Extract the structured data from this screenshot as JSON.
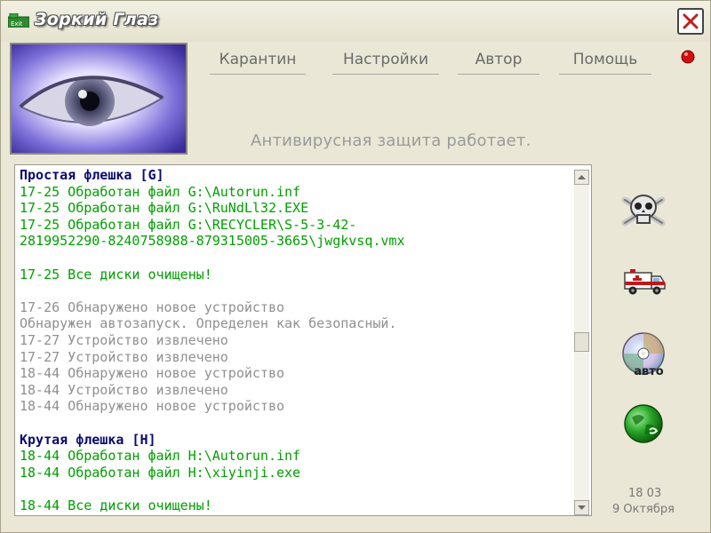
{
  "window": {
    "title": "Зоркий Глаз"
  },
  "menu": [
    {
      "label": "Карантин"
    },
    {
      "label": "Настройки"
    },
    {
      "label": "Автор"
    },
    {
      "label": "Помощь"
    }
  ],
  "status": {
    "text": "Антивирусная защита работает."
  },
  "log": [
    {
      "text": "Простая флешка [G]",
      "style": "header"
    },
    {
      "text": "17-25 Обработан файл G:\\Autorun.inf",
      "style": "green"
    },
    {
      "text": "17-25 Обработан файл G:\\RuNdLl32.EXE",
      "style": "green"
    },
    {
      "text": "17-25 Обработан файл G:\\RECYCLER\\S-5-3-42-",
      "style": "green"
    },
    {
      "text": "2819952290-8240758988-879315005-3665\\jwgkvsq.vmx",
      "style": "green"
    },
    {
      "text": "",
      "style": "green"
    },
    {
      "text": "17-25 Все диски очищены!",
      "style": "green"
    },
    {
      "text": "",
      "style": "grey"
    },
    {
      "text": "17-26 Обнаружено новое устройство",
      "style": "grey"
    },
    {
      "text": "Обнаружен автозапуск. Определен как безопасный.",
      "style": "grey"
    },
    {
      "text": "17-27 Устройство извлечено",
      "style": "grey"
    },
    {
      "text": "17-27 Устройство извлечено",
      "style": "grey"
    },
    {
      "text": "18-44 Обнаружено новое устройство",
      "style": "grey"
    },
    {
      "text": "18-44 Устройство извлечено",
      "style": "grey"
    },
    {
      "text": "18-44 Обнаружено новое устройство",
      "style": "grey"
    },
    {
      "text": "",
      "style": "grey"
    },
    {
      "text": "Крутая флешка [H]",
      "style": "header"
    },
    {
      "text": "18-44 Обработан файл H:\\Autorun.inf",
      "style": "green"
    },
    {
      "text": "18-44 Обработан файл H:\\xiyinji.exe",
      "style": "green"
    },
    {
      "text": "",
      "style": "green"
    },
    {
      "text": "18-44 Все диски очищены!",
      "style": "green"
    }
  ],
  "side": {
    "icons": [
      "skull-crossbones-icon",
      "ambulance-icon",
      "cd-disc-icon",
      "green-globe-icon"
    ],
    "auto_label": "авто"
  },
  "clock": {
    "time": "18 03",
    "date": "9 Октября"
  },
  "colors": {
    "log_header": "#0a0a6e",
    "log_green": "#00a000",
    "log_grey": "#909090",
    "status_dot": "#d01010"
  }
}
